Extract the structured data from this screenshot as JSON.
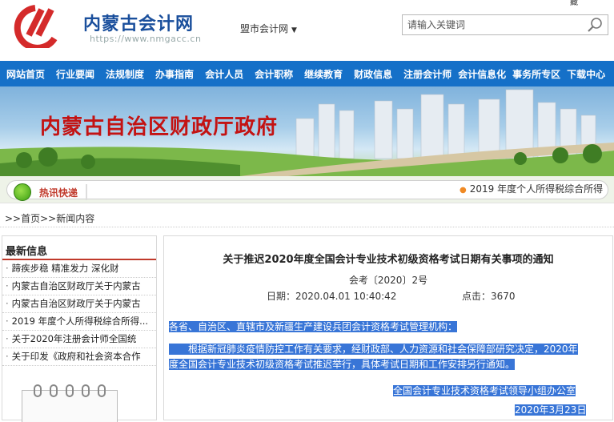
{
  "header": {
    "corner_char": "藏",
    "logo_title": "内蒙古会计网",
    "logo_url": "https://www.nmgacc.cn",
    "region_selector": "盟市会计网",
    "search_placeholder": "请输入关键词"
  },
  "nav": [
    "网站首页",
    "行业要闻",
    "法规制度",
    "办事指南",
    "会计人员",
    "会计职称",
    "继续教育",
    "财政信息",
    "注册会计师",
    "会计信息化",
    "事务所专区",
    "下载中心"
  ],
  "banner": {
    "title": "内蒙古自治区财政厅政府"
  },
  "ticker": {
    "label": "热讯快递",
    "text": "2019 年度个人所得税综合所得"
  },
  "breadcrumb": {
    "prefix": ">>",
    "home": "首页",
    "sep": ">>",
    "current": "新闻内容"
  },
  "sidebar": {
    "title": "最新信息",
    "items": [
      "蹄疾步稳 精准发力 深化财",
      "内蒙古自治区财政厅关于内蒙古",
      "内蒙古自治区财政厅关于内蒙古",
      "2019 年度个人所得税综合所得...",
      "关于2020年注册会计师全国统",
      "关于印发《政府和社会资本合作"
    ]
  },
  "article": {
    "title": "关于推迟2020年度全国会计专业技术初级资格考试日期有关事项的通知",
    "code": "会考〔2020〕2号",
    "date_label": "日期：",
    "date": "2020.04.01 10:40:42",
    "clicks_label": "点击：",
    "clicks": "3670",
    "salutation": "各省、自治区、直辖市及新疆生产建设兵团会计资格考试管理机构：",
    "body_line1": "根据新冠肺炎疫情防控工作有关要求，经财政部、人力资源和社会保障部研究决定，2020年",
    "body_line2": "度全国会计专业技术初级资格考试推迟举行，具体考试日期和工作安排另行通知。",
    "signature": "全国会计专业技术资格考试领导小组办公室",
    "sign_date": "2020年3月23日"
  },
  "colors": {
    "nav_bg": "#1570c8",
    "logo_red": "#d42a2a",
    "logo_blue": "#1a4f9c",
    "highlight": "#3875d7"
  }
}
